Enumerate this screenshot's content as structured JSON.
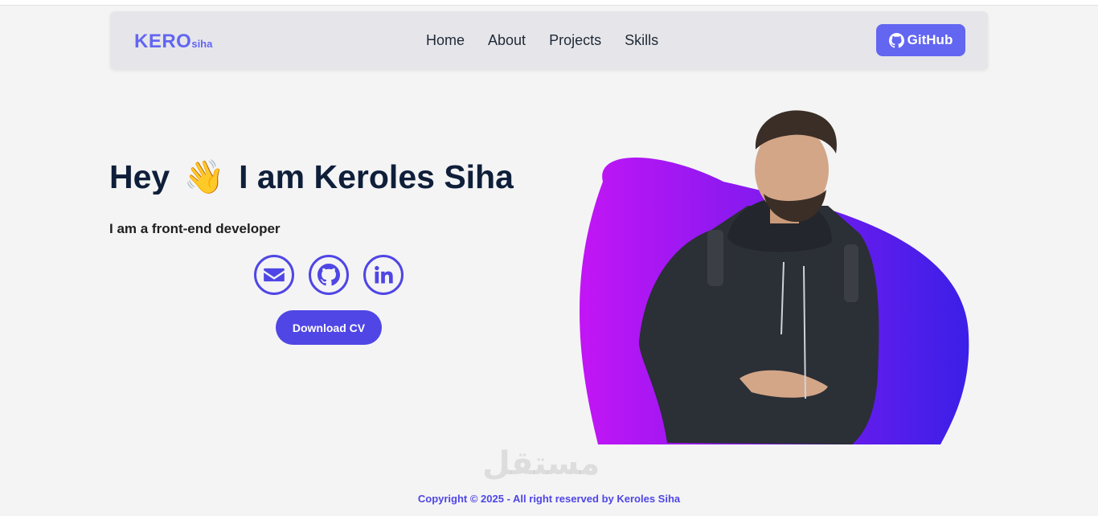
{
  "navbar": {
    "brand_main": "KERO",
    "brand_sub": "siha",
    "links": [
      "Home",
      "About",
      "Projects",
      "Skills"
    ],
    "github_label": "GitHub"
  },
  "hero": {
    "title_prefix": "Hey",
    "wave_emoji": "👋",
    "title_suffix": "I am Keroles Siha",
    "subtitle": "I am a front-end developer",
    "socials": [
      "envelope-icon",
      "github-icon",
      "linkedin-icon"
    ],
    "cv_button": "Download CV"
  },
  "colors": {
    "accent": "#6366f1",
    "accent_dark": "#4f46e5",
    "blob_start": "#c315f5",
    "blob_end": "#3b1fe8"
  },
  "footer": {
    "copyright": "Copyright © 2025 - All right reserved by Keroles Siha"
  },
  "watermark": "مستقل"
}
